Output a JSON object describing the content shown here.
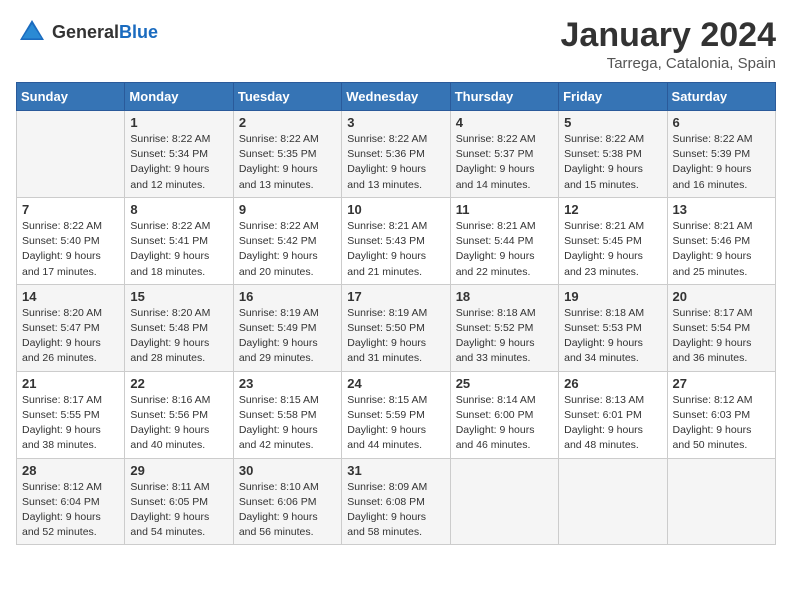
{
  "header": {
    "logo_general": "General",
    "logo_blue": "Blue",
    "month_title": "January 2024",
    "location": "Tarrega, Catalonia, Spain"
  },
  "weekdays": [
    "Sunday",
    "Monday",
    "Tuesday",
    "Wednesday",
    "Thursday",
    "Friday",
    "Saturday"
  ],
  "weeks": [
    [
      {
        "day": "",
        "detail": ""
      },
      {
        "day": "1",
        "detail": "Sunrise: 8:22 AM\nSunset: 5:34 PM\nDaylight: 9 hours\nand 12 minutes."
      },
      {
        "day": "2",
        "detail": "Sunrise: 8:22 AM\nSunset: 5:35 PM\nDaylight: 9 hours\nand 13 minutes."
      },
      {
        "day": "3",
        "detail": "Sunrise: 8:22 AM\nSunset: 5:36 PM\nDaylight: 9 hours\nand 13 minutes."
      },
      {
        "day": "4",
        "detail": "Sunrise: 8:22 AM\nSunset: 5:37 PM\nDaylight: 9 hours\nand 14 minutes."
      },
      {
        "day": "5",
        "detail": "Sunrise: 8:22 AM\nSunset: 5:38 PM\nDaylight: 9 hours\nand 15 minutes."
      },
      {
        "day": "6",
        "detail": "Sunrise: 8:22 AM\nSunset: 5:39 PM\nDaylight: 9 hours\nand 16 minutes."
      }
    ],
    [
      {
        "day": "7",
        "detail": "Sunrise: 8:22 AM\nSunset: 5:40 PM\nDaylight: 9 hours\nand 17 minutes."
      },
      {
        "day": "8",
        "detail": "Sunrise: 8:22 AM\nSunset: 5:41 PM\nDaylight: 9 hours\nand 18 minutes."
      },
      {
        "day": "9",
        "detail": "Sunrise: 8:22 AM\nSunset: 5:42 PM\nDaylight: 9 hours\nand 20 minutes."
      },
      {
        "day": "10",
        "detail": "Sunrise: 8:21 AM\nSunset: 5:43 PM\nDaylight: 9 hours\nand 21 minutes."
      },
      {
        "day": "11",
        "detail": "Sunrise: 8:21 AM\nSunset: 5:44 PM\nDaylight: 9 hours\nand 22 minutes."
      },
      {
        "day": "12",
        "detail": "Sunrise: 8:21 AM\nSunset: 5:45 PM\nDaylight: 9 hours\nand 23 minutes."
      },
      {
        "day": "13",
        "detail": "Sunrise: 8:21 AM\nSunset: 5:46 PM\nDaylight: 9 hours\nand 25 minutes."
      }
    ],
    [
      {
        "day": "14",
        "detail": "Sunrise: 8:20 AM\nSunset: 5:47 PM\nDaylight: 9 hours\nand 26 minutes."
      },
      {
        "day": "15",
        "detail": "Sunrise: 8:20 AM\nSunset: 5:48 PM\nDaylight: 9 hours\nand 28 minutes."
      },
      {
        "day": "16",
        "detail": "Sunrise: 8:19 AM\nSunset: 5:49 PM\nDaylight: 9 hours\nand 29 minutes."
      },
      {
        "day": "17",
        "detail": "Sunrise: 8:19 AM\nSunset: 5:50 PM\nDaylight: 9 hours\nand 31 minutes."
      },
      {
        "day": "18",
        "detail": "Sunrise: 8:18 AM\nSunset: 5:52 PM\nDaylight: 9 hours\nand 33 minutes."
      },
      {
        "day": "19",
        "detail": "Sunrise: 8:18 AM\nSunset: 5:53 PM\nDaylight: 9 hours\nand 34 minutes."
      },
      {
        "day": "20",
        "detail": "Sunrise: 8:17 AM\nSunset: 5:54 PM\nDaylight: 9 hours\nand 36 minutes."
      }
    ],
    [
      {
        "day": "21",
        "detail": "Sunrise: 8:17 AM\nSunset: 5:55 PM\nDaylight: 9 hours\nand 38 minutes."
      },
      {
        "day": "22",
        "detail": "Sunrise: 8:16 AM\nSunset: 5:56 PM\nDaylight: 9 hours\nand 40 minutes."
      },
      {
        "day": "23",
        "detail": "Sunrise: 8:15 AM\nSunset: 5:58 PM\nDaylight: 9 hours\nand 42 minutes."
      },
      {
        "day": "24",
        "detail": "Sunrise: 8:15 AM\nSunset: 5:59 PM\nDaylight: 9 hours\nand 44 minutes."
      },
      {
        "day": "25",
        "detail": "Sunrise: 8:14 AM\nSunset: 6:00 PM\nDaylight: 9 hours\nand 46 minutes."
      },
      {
        "day": "26",
        "detail": "Sunrise: 8:13 AM\nSunset: 6:01 PM\nDaylight: 9 hours\nand 48 minutes."
      },
      {
        "day": "27",
        "detail": "Sunrise: 8:12 AM\nSunset: 6:03 PM\nDaylight: 9 hours\nand 50 minutes."
      }
    ],
    [
      {
        "day": "28",
        "detail": "Sunrise: 8:12 AM\nSunset: 6:04 PM\nDaylight: 9 hours\nand 52 minutes."
      },
      {
        "day": "29",
        "detail": "Sunrise: 8:11 AM\nSunset: 6:05 PM\nDaylight: 9 hours\nand 54 minutes."
      },
      {
        "day": "30",
        "detail": "Sunrise: 8:10 AM\nSunset: 6:06 PM\nDaylight: 9 hours\nand 56 minutes."
      },
      {
        "day": "31",
        "detail": "Sunrise: 8:09 AM\nSunset: 6:08 PM\nDaylight: 9 hours\nand 58 minutes."
      },
      {
        "day": "",
        "detail": ""
      },
      {
        "day": "",
        "detail": ""
      },
      {
        "day": "",
        "detail": ""
      }
    ]
  ]
}
